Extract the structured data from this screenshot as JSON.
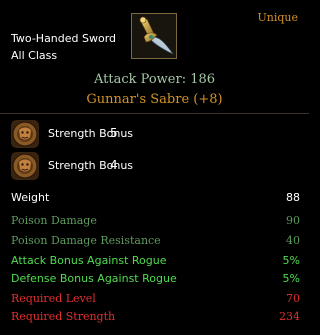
{
  "header": {
    "item_type": "Two-Handed Sword",
    "class_restriction": "All Class",
    "rarity": "Unique",
    "rarity_color": "#d4922a",
    "icon": "sabre-icon"
  },
  "attack_line": "Attack Power: 186",
  "attack_color": "#a8c8a8",
  "item_name": "Gunnar's Sabre (+8)",
  "item_name_color": "#d4922a",
  "bonuses": [
    {
      "icon": "lion-crest-icon",
      "label": "Strength Bonus",
      "value": "5"
    },
    {
      "icon": "lion-crest-icon",
      "label": "Strength Bonus",
      "value": "4"
    }
  ],
  "weight": {
    "label": "Weight",
    "value": "88"
  },
  "stats": [
    {
      "label": "Poison Damage",
      "value": "90",
      "color": "#5e9a5e"
    },
    {
      "label": "Poison Damage Resistance",
      "value": "40",
      "color": "#5e9a5e"
    },
    {
      "label": "Attack Bonus Against Rogue",
      "value": "5%",
      "color": "#4fdc4f"
    },
    {
      "label": "Defense Bonus Against Rogue",
      "value": "5%",
      "color": "#4fdc4f"
    },
    {
      "label": "Required Level",
      "value": "70",
      "color": "#e03030"
    },
    {
      "label": "Required Strength",
      "value": "234",
      "color": "#e03030"
    }
  ]
}
